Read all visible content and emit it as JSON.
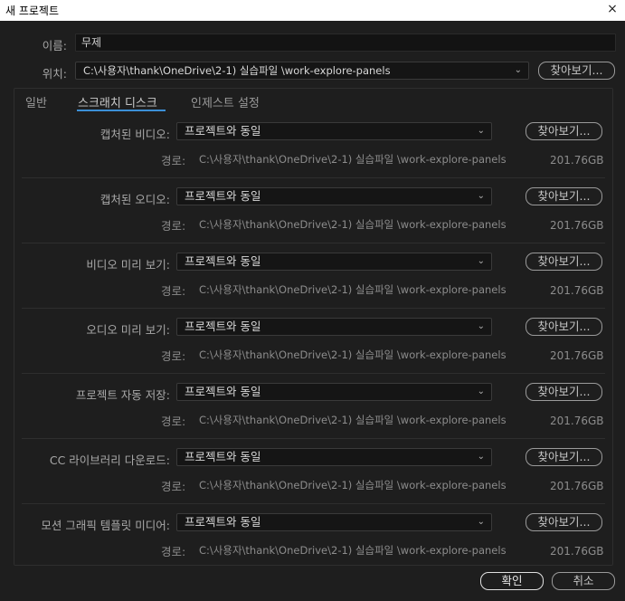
{
  "window": {
    "title": "새 프로젝트",
    "close_icon": "×"
  },
  "name": {
    "label": "이름:",
    "value": "무제"
  },
  "location": {
    "label": "위치:",
    "value": "C:\\사용자\\thank\\OneDrive\\2-1) 실습파일 \\work-explore-panels",
    "browse_label": "찾아보기..."
  },
  "tabs": [
    {
      "label": "일반"
    },
    {
      "label": "스크래치 디스크"
    },
    {
      "label": "인제스트 설정"
    }
  ],
  "scratch": {
    "path_label": "경로:",
    "browse_label": "찾아보기...",
    "rows": [
      {
        "label": "캡처된 비디오:",
        "select": "프로젝트와 동일",
        "path": "C:\\사용자\\thank\\OneDrive\\2-1) 실습파일 \\work-explore-panels",
        "size": "201.76GB"
      },
      {
        "label": "캡처된 오디오:",
        "select": "프로젝트와 동일",
        "path": "C:\\사용자\\thank\\OneDrive\\2-1) 실습파일 \\work-explore-panels",
        "size": "201.76GB"
      },
      {
        "label": "비디오 미리 보기:",
        "select": "프로젝트와 동일",
        "path": "C:\\사용자\\thank\\OneDrive\\2-1) 실습파일 \\work-explore-panels",
        "size": "201.76GB"
      },
      {
        "label": "오디오 미리 보기:",
        "select": "프로젝트와 동일",
        "path": "C:\\사용자\\thank\\OneDrive\\2-1) 실습파일 \\work-explore-panels",
        "size": "201.76GB"
      },
      {
        "label": "프로젝트 자동 저장:",
        "select": "프로젝트와 동일",
        "path": "C:\\사용자\\thank\\OneDrive\\2-1) 실습파일 \\work-explore-panels",
        "size": "201.76GB"
      },
      {
        "label": "CC 라이브러리 다운로드:",
        "select": "프로젝트와 동일",
        "path": "C:\\사용자\\thank\\OneDrive\\2-1) 실습파일 \\work-explore-panels",
        "size": "201.76GB"
      },
      {
        "label": "모션 그래픽 템플릿 미디어:",
        "select": "프로젝트와 동일",
        "path": "C:\\사용자\\thank\\OneDrive\\2-1) 실습파일 \\work-explore-panels",
        "size": "201.76GB"
      }
    ]
  },
  "footer": {
    "ok_label": "확인",
    "cancel_label": "취소"
  }
}
